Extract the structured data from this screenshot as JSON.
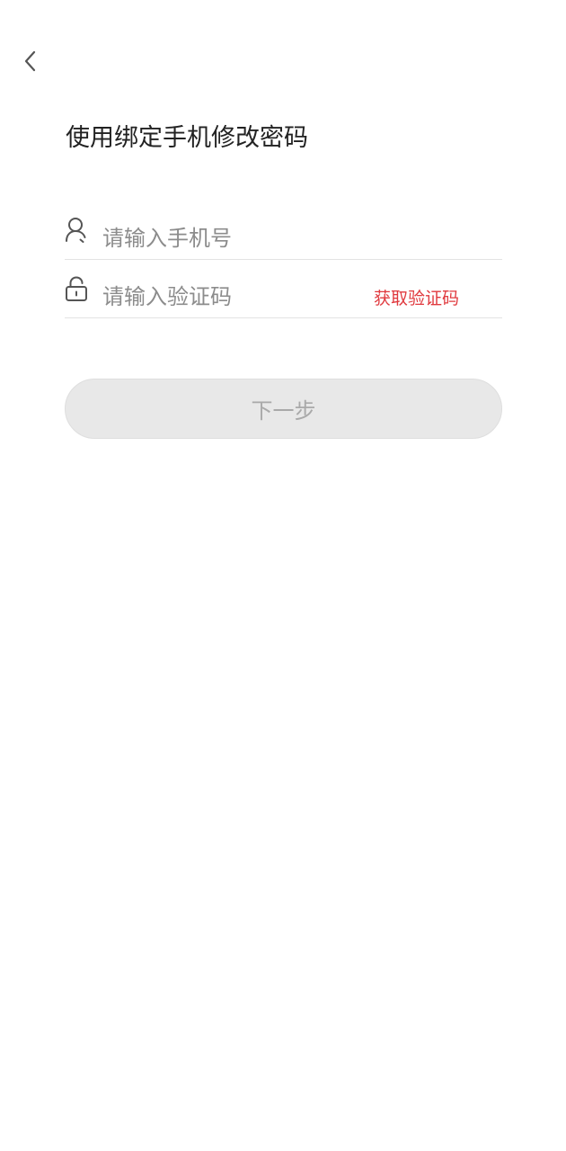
{
  "header": {
    "back_icon": "chevron-left-icon",
    "title": "使用绑定手机修改密码"
  },
  "form": {
    "phone": {
      "icon": "user-icon",
      "value": "",
      "placeholder": "请输入手机号"
    },
    "code": {
      "icon": "lock-icon",
      "value": "",
      "placeholder": "请输入验证码",
      "get_code_label": "获取验证码"
    },
    "next_label": "下一步"
  },
  "colors": {
    "accent": "#e0393e",
    "button_disabled_bg": "#e8e8e8",
    "button_disabled_text": "#a9a9a9",
    "divider": "#e3e3e3"
  }
}
